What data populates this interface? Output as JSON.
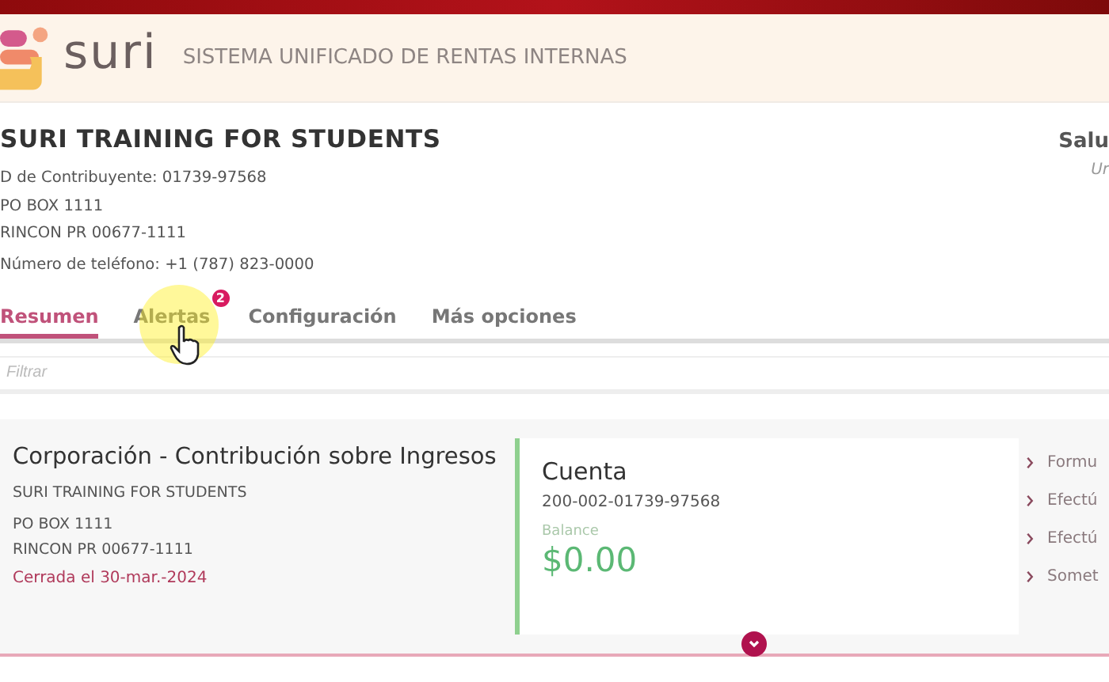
{
  "brand": {
    "name": "suri",
    "subtitle": "SISTEMA UNIFICADO DE RENTAS INTERNAS"
  },
  "taxpayer": {
    "name": "SURI TRAINING FOR STUDENTS",
    "lines": [
      "D de Contribuyente: 01739-97568",
      "PO BOX 1111",
      "RINCON PR 00677-1111",
      "Número de teléfono: +1 (787) 823-0000"
    ]
  },
  "greeting": {
    "title": "Salu",
    "subtitle": "Ur"
  },
  "tabs": [
    {
      "label": "Resumen",
      "selected": true
    },
    {
      "label": "Alertas",
      "selected": false,
      "badge": "2"
    },
    {
      "label": "Configuración",
      "selected": false
    },
    {
      "label": "Más opciones",
      "selected": false
    }
  ],
  "filter": {
    "placeholder": "Filtrar"
  },
  "account": {
    "title": "Corporación - Contribución sobre Ingresos",
    "lines": [
      "SURI TRAINING FOR STUDENTS",
      "PO BOX 1111",
      "RINCON PR 00677-1111"
    ],
    "status": "Cerrada el 30-mar.-2024",
    "card": {
      "title": "Cuenta",
      "number": "200-002-01739-97568",
      "balance_label": "Balance",
      "balance": "$0.00"
    },
    "actions": [
      "Formu",
      "Efectú",
      "Efectú",
      "Somet"
    ]
  }
}
